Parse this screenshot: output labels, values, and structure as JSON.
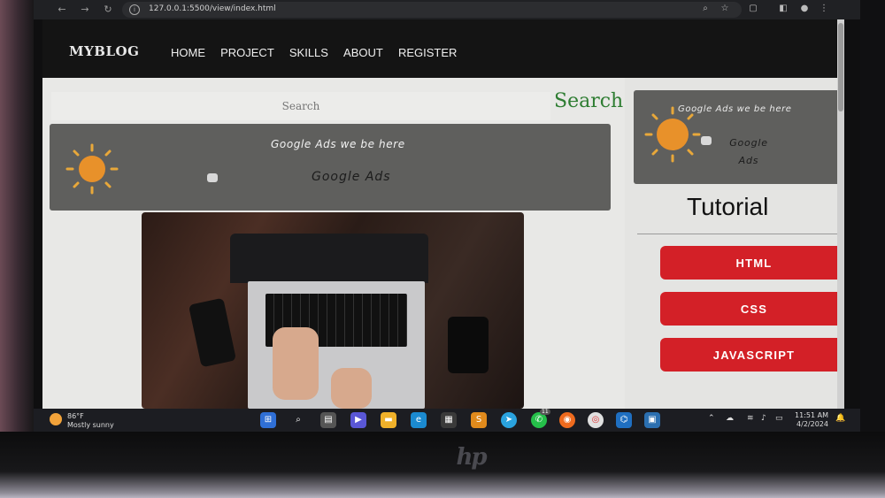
{
  "browser": {
    "url": "127.0.0.1:5500/view/index.html"
  },
  "site": {
    "brand": "MYBLOG",
    "nav": [
      "HOME",
      "PROJECT",
      "SKILLS",
      "ABOUT",
      "REGISTER"
    ]
  },
  "search": {
    "placeholder": "Search",
    "button_label": "Search",
    "accent_color": "#2e7d32"
  },
  "main_ad": {
    "top_text": "Google Ads we be here",
    "mid_text": "Google Ads"
  },
  "sidebar": {
    "ad_top_text": "Google Ads we be here",
    "ad_mid_text": "Google Ads",
    "tutorial_title": "Tutorial",
    "buttons": [
      "HTML",
      "CSS",
      "JAVASCRIPT"
    ],
    "button_color": "#d32027"
  },
  "taskbar": {
    "weather_temp": "86°F",
    "weather_desc": "Mostly sunny",
    "time": "11:51 AM",
    "date": "4/2/2024",
    "whatsapp_badge": "11"
  }
}
